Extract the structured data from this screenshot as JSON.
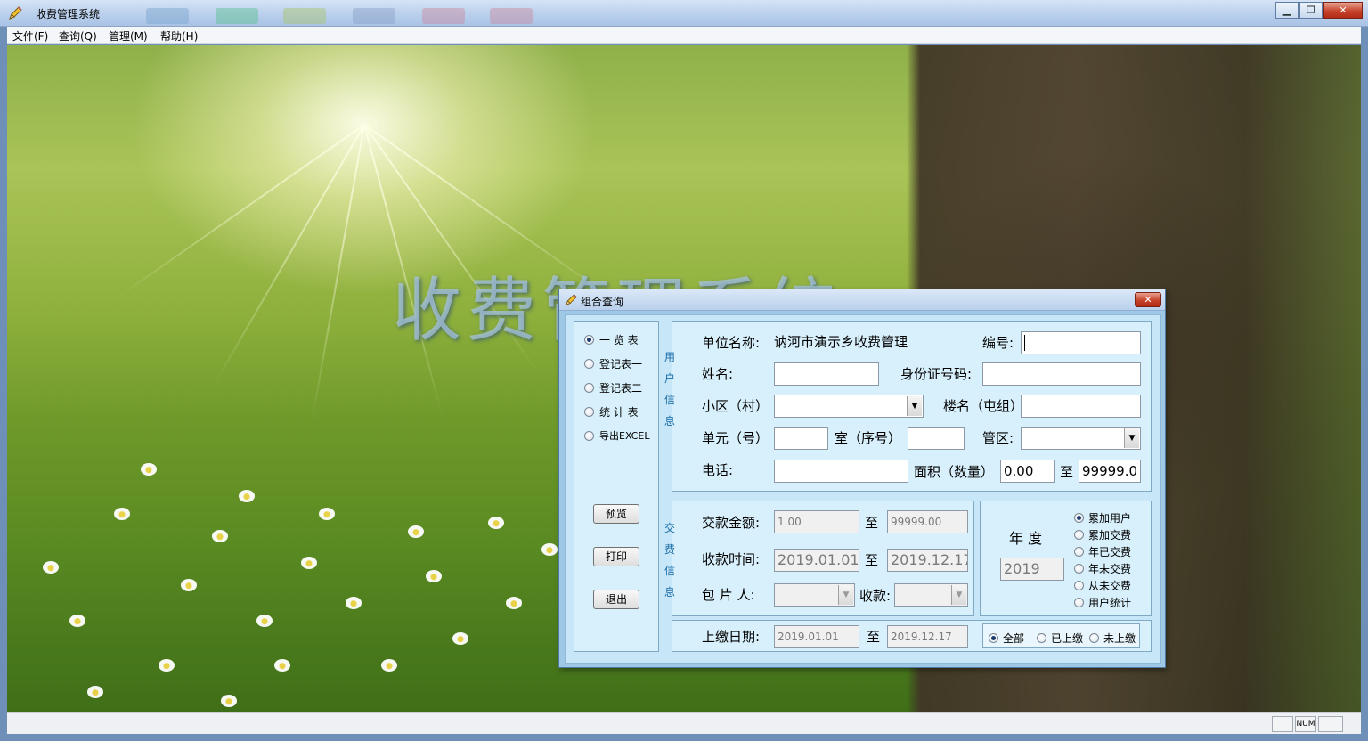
{
  "window": {
    "title": "收费管理系统"
  },
  "menu": [
    {
      "label": "文件(F)"
    },
    {
      "label": "查询(Q)"
    },
    {
      "label": "管理(M)"
    },
    {
      "label": "帮助(H)"
    }
  ],
  "background_title": "收费管理系统",
  "status": {
    "num": "NUM"
  },
  "dialog": {
    "title": "组合查询",
    "report_types": [
      {
        "label": "一 览 表",
        "selected": true
      },
      {
        "label": "登记表一",
        "selected": false
      },
      {
        "label": "登记表二",
        "selected": false
      },
      {
        "label": "统 计 表",
        "selected": false
      },
      {
        "label": "导出EXCEL",
        "selected": false
      }
    ],
    "buttons": {
      "preview": "预览",
      "print": "打印",
      "exit": "退出"
    },
    "user_info": {
      "side_label": [
        "用",
        "户",
        "信",
        "息"
      ],
      "unit_label": "单位名称:",
      "unit_value": "讷河市演示乡收费管理",
      "id_label": "编号:",
      "id_value": "",
      "name_label": "姓名:",
      "name_value": "",
      "idcard_label": "身份证号码:",
      "idcard_value": "",
      "community_label": "小区（村）",
      "community_value": "",
      "building_label": "楼名（屯组）",
      "building_value": "",
      "unit_no_label": "单元（号）",
      "unit_no_value": "",
      "room_label": "室（序号）",
      "room_value": "",
      "district_label": "管区:",
      "district_value": "",
      "phone_label": "电话:",
      "phone_value": "",
      "area_label": "面积（数量）",
      "area_from": "0.00",
      "to_label": "至",
      "area_to": "99999.0"
    },
    "payment_info": {
      "side_label": [
        "交",
        "费",
        "信",
        "息"
      ],
      "amount_label": "交款金额:",
      "amount_from": "1.00",
      "amount_to": "99999.00",
      "time_label": "收款时间:",
      "time_from": "2019.01.01",
      "time_to": "2019.12.17",
      "contractor_label": "包 片 人:",
      "contractor_value": "",
      "collect_label": "收款:",
      "collect_value": "",
      "to_label": "至"
    },
    "year": {
      "label": "年  度",
      "value": "2019",
      "options": [
        {
          "label": "累加用户",
          "selected": true
        },
        {
          "label": "累加交费",
          "selected": false
        },
        {
          "label": "年已交费",
          "selected": false
        },
        {
          "label": "年未交费",
          "selected": false
        },
        {
          "label": "从未交费",
          "selected": false
        },
        {
          "label": "用户统计",
          "selected": false
        }
      ]
    },
    "upload": {
      "label": "上缴日期:",
      "date_from": "2019.01.01",
      "to_label": "至",
      "date_to": "2019.12.17",
      "options": [
        {
          "label": "全部",
          "selected": true
        },
        {
          "label": "已上缴",
          "selected": false
        },
        {
          "label": "未上缴",
          "selected": false
        }
      ]
    }
  }
}
